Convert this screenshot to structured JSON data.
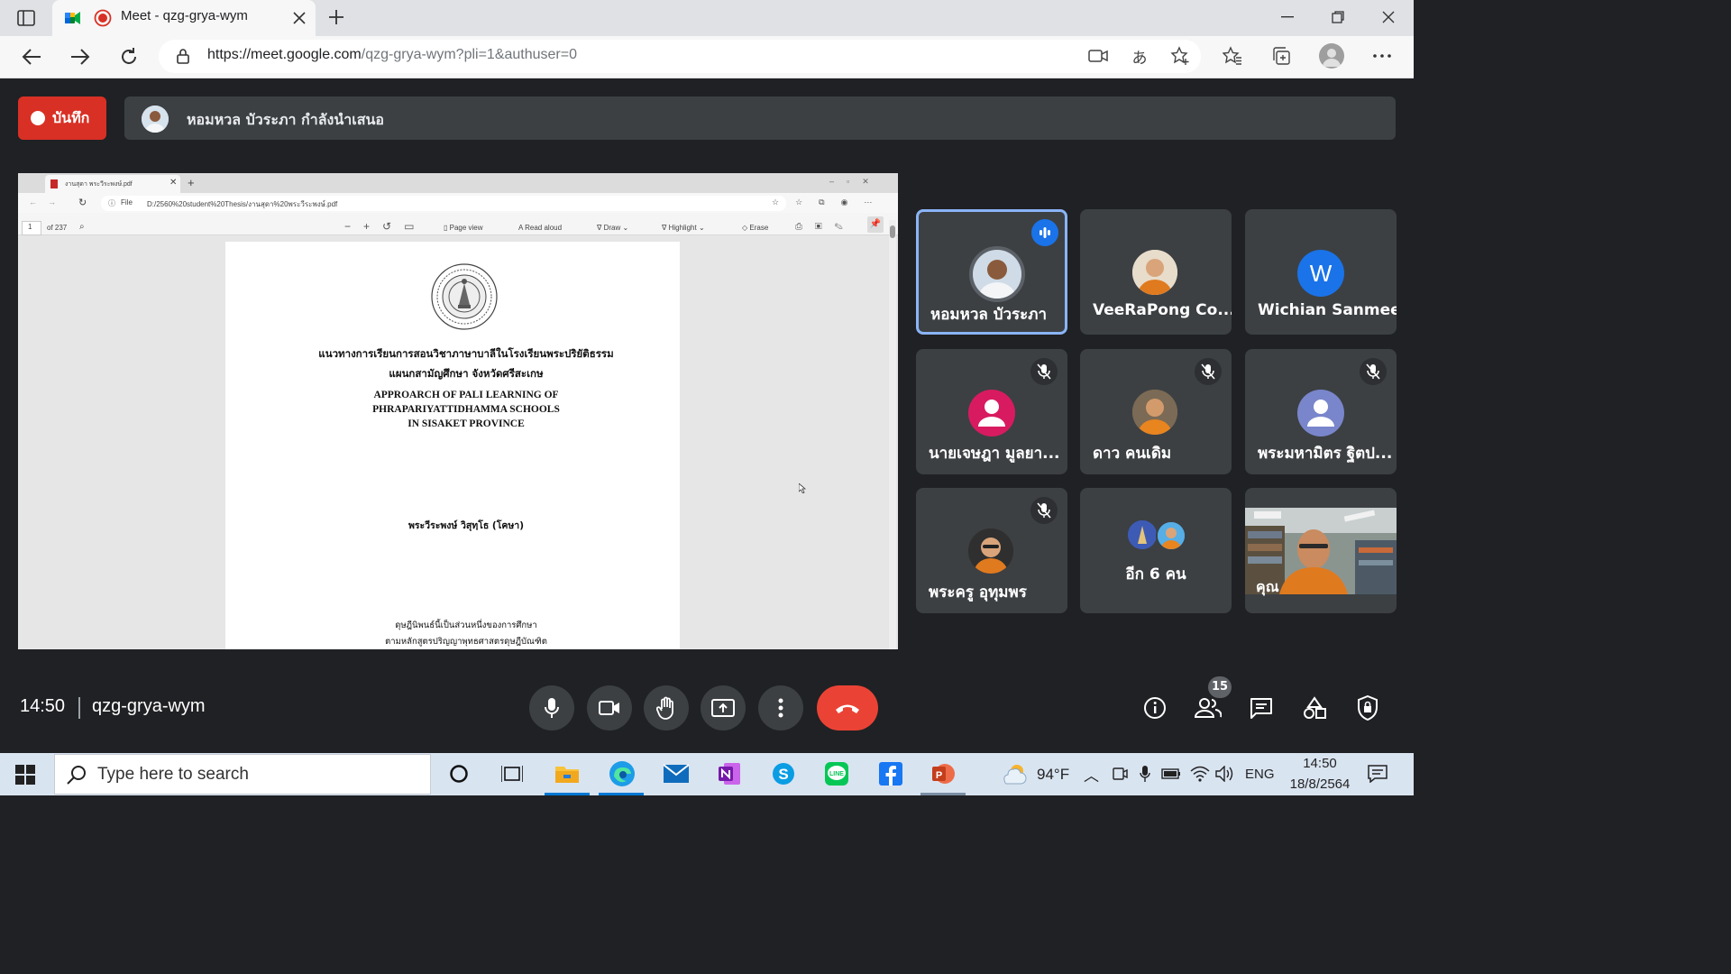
{
  "browser": {
    "tab_title": "Meet - qzg-grya-wym",
    "url_host": "https://meet.google.com",
    "url_path": "/qzg-grya-wym?pli=1&authuser=0"
  },
  "meet": {
    "record_label": "บันทึก",
    "presenting_text": "หอมหวล บัวระภา กำลังนำเสนอ",
    "time": "14:50",
    "meeting_code": "qzg-grya-wym",
    "participant_count": "15"
  },
  "shared_screen": {
    "tab_title": "งานสุดา พระวีระพงษ์.pdf",
    "file_label": "File",
    "path": "D:/2560%20student%20Thesis/งานสุดา%20พระวีระพงษ์.pdf",
    "page_number": "1",
    "page_total": "of 237",
    "toolbar": {
      "page_view": "Page view",
      "read_aloud": "Read aloud",
      "draw": "Draw",
      "highlight": "Highlight",
      "erase": "Erase"
    },
    "document": {
      "thai_title_1": "แนวทางการเรียนการสอนวิชาภาษาบาลีในโรงเรียนพระปริยัติธรรม",
      "thai_title_2": "แผนกสามัญศึกษา จังหวัดศรีสะเกษ",
      "en_title_1": "APPROARCH OF PALI LEARNING OF",
      "en_title_2": "PHRAPARIYATTIDHAMMA SCHOOLS",
      "en_title_3": "IN SISAKET PROVINCE",
      "author": "พระวีระพงษ์  วิสุทฺโธ (โคษา)",
      "footer_1": "ดุษฎีนิพนธ์นี้เป็นส่วนหนึ่งของการศึกษา",
      "footer_2": "ตามหลักสูตรปริญญาพุทธศาสตรดุษฎีบัณฑิต"
    }
  },
  "participants": [
    {
      "name": "หอมหวล บัวระภา",
      "state": "speaking"
    },
    {
      "name": "VeeRaPong Co...",
      "state": "normal"
    },
    {
      "name": "Wichian Sanmee",
      "initial": "W",
      "state": "normal"
    },
    {
      "name": "นายเจษฎา มูลยา...",
      "state": "muted"
    },
    {
      "name": "ดาว คนเดิม",
      "state": "muted"
    },
    {
      "name": "พระมหามิตร ฐิตป...",
      "state": "muted"
    },
    {
      "name": "พระครู อุทุมพร",
      "state": "muted"
    },
    {
      "name": "อีก 6 คน",
      "state": "group"
    },
    {
      "name": "คุณ",
      "state": "self"
    }
  ],
  "taskbar": {
    "search_placeholder": "Type here to search",
    "weather": "94°F",
    "language": "ENG",
    "clock_time": "14:50",
    "clock_date": "18/8/2564"
  },
  "colors": {
    "meet_bg": "#202124",
    "tile_bg": "#3c4043",
    "record_red": "#d93025",
    "active_blue": "#8ab4f8",
    "avatar_pink": "#d81b60",
    "avatar_purple": "#7986cb",
    "avatar_blue": "#1a73e8"
  }
}
